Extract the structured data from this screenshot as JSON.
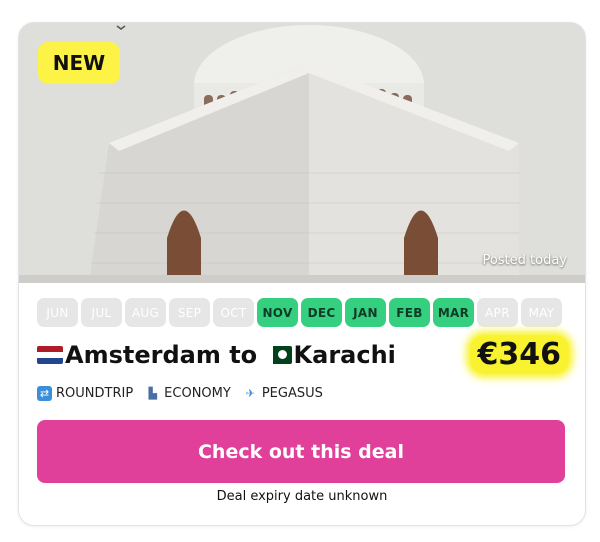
{
  "badge": {
    "label": "NEW"
  },
  "hero": {
    "posted_label": "Posted today"
  },
  "months": [
    {
      "label": "JUN",
      "active": false
    },
    {
      "label": "JUL",
      "active": false
    },
    {
      "label": "AUG",
      "active": false
    },
    {
      "label": "SEP",
      "active": false
    },
    {
      "label": "OCT",
      "active": false
    },
    {
      "label": "NOV",
      "active": true
    },
    {
      "label": "DEC",
      "active": true
    },
    {
      "label": "JAN",
      "active": true
    },
    {
      "label": "FEB",
      "active": true
    },
    {
      "label": "MAR",
      "active": true
    },
    {
      "label": "APR",
      "active": false
    },
    {
      "label": "MAY",
      "active": false
    }
  ],
  "route": {
    "origin": "Amsterdam",
    "connector": "to",
    "destination": "Karachi"
  },
  "price": {
    "value": "€346"
  },
  "meta": {
    "trip_type": "ROUNDTRIP",
    "cabin": "ECONOMY",
    "airline": "PEGASUS"
  },
  "cta": {
    "label": "Check out this deal"
  },
  "expiry": {
    "label": "Deal expiry date unknown"
  },
  "colors": {
    "accent_pink": "#e0409a",
    "month_active": "#35d07f",
    "highlight_yellow": "#f9f32f",
    "badge_yellow": "#fcf346"
  },
  "icons": {
    "roundtrip": "roundtrip-icon",
    "cabin": "seat-icon",
    "airline": "airplane-icon"
  }
}
